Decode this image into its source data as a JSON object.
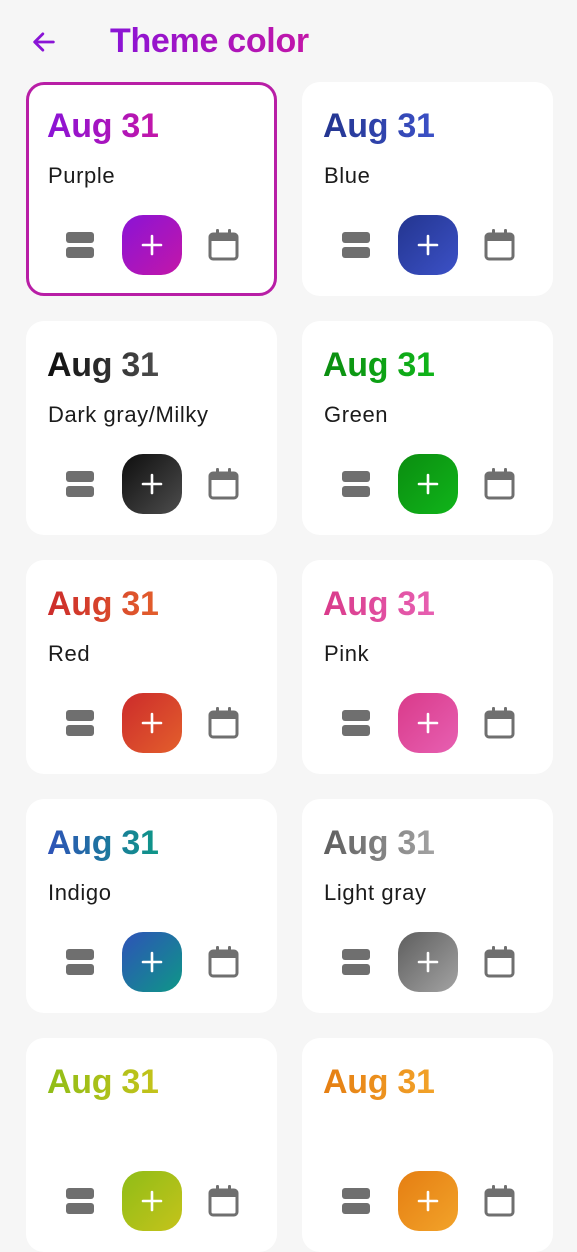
{
  "header": {
    "back_icon": "arrow-left-icon",
    "title": "Theme color",
    "accent": "#8a14d6"
  },
  "themes": [
    {
      "date": "Aug 31",
      "name": "Purple",
      "selected": true,
      "colors": [
        "#8a14d6",
        "#c316a8"
      ]
    },
    {
      "date": "Aug 31",
      "name": "Blue",
      "selected": false,
      "colors": [
        "#23358f",
        "#3c51c7"
      ]
    },
    {
      "date": "Aug 31",
      "name": "Dark gray/Milky",
      "selected": false,
      "colors": [
        "#0e0e0e",
        "#4d4d4d"
      ]
    },
    {
      "date": "Aug 31",
      "name": "Green",
      "selected": false,
      "colors": [
        "#0b8d10",
        "#10b51a"
      ]
    },
    {
      "date": "Aug 31",
      "name": "Red",
      "selected": false,
      "colors": [
        "#cc2b2b",
        "#e35f2c"
      ]
    },
    {
      "date": "Aug 31",
      "name": "Pink",
      "selected": false,
      "colors": [
        "#d93a8a",
        "#e760b2"
      ]
    },
    {
      "date": "Aug 31",
      "name": "Indigo",
      "selected": false,
      "colors": [
        "#2e52b8",
        "#0e9787"
      ]
    },
    {
      "date": "Aug 31",
      "name": "Light gray",
      "selected": false,
      "colors": [
        "#5e5e5e",
        "#a3a3a3"
      ]
    },
    {
      "date": "Aug 31",
      "name": "",
      "selected": false,
      "colors": [
        "#8fbd17",
        "#c5c31b"
      ]
    },
    {
      "date": "Aug 31",
      "name": "",
      "selected": false,
      "colors": [
        "#e57e12",
        "#f2a32a"
      ]
    }
  ],
  "card_icons": {
    "list": "list-icon",
    "add": "plus-icon",
    "calendar": "calendar-icon"
  }
}
